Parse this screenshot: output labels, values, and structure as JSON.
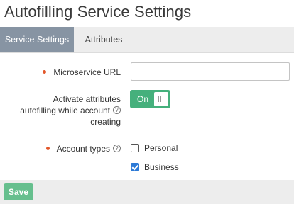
{
  "page": {
    "title": "Autofilling Service Settings"
  },
  "tabs": [
    {
      "label": "Service Settings",
      "active": true
    },
    {
      "label": "Attributes",
      "active": false
    }
  ],
  "form": {
    "microservice_url": {
      "label": "Microservice URL",
      "required": true,
      "value": "",
      "placeholder": ""
    },
    "activate": {
      "label_lines": [
        "Activate attributes",
        "autofilling while account",
        "creating"
      ],
      "state_label": "On",
      "enabled": true
    },
    "account_types": {
      "label": "Account types",
      "required": true,
      "options": [
        {
          "label": "Personal",
          "checked": false
        },
        {
          "label": "Business",
          "checked": true
        }
      ]
    }
  },
  "actions": {
    "save_label": "Save"
  },
  "colors": {
    "active_tab": "#8794a3",
    "toggle_on": "#45b07c",
    "save_button": "#66bf8e",
    "required_dot": "#e2572b",
    "checkbox_checked": "#2d7ad6"
  },
  "icons": {
    "help": "question-circle-icon",
    "toggle_grip": "grip-lines-icon",
    "check": "checkmark-icon"
  }
}
